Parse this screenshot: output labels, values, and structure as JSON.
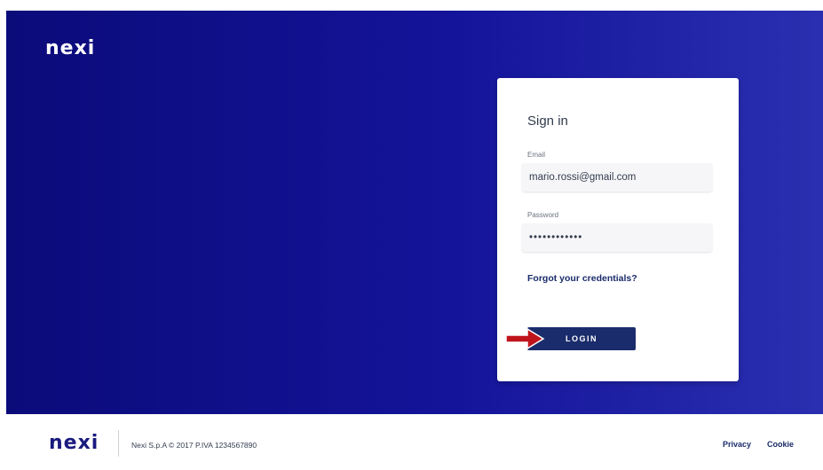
{
  "header": {
    "logo_text": "nexi"
  },
  "login_card": {
    "title": "Sign in",
    "email": {
      "label": "Email",
      "value": "mario.rossi@gmail.com"
    },
    "password": {
      "label": "Password",
      "value": "••••••••••••"
    },
    "forgot_link": "Forgot your credentials?",
    "login_button": "LOGIN"
  },
  "footer": {
    "logo_text": "nexi",
    "copyright": "Nexi S.p.A © 2017 P.IVA 1234567890",
    "links": [
      "Privacy",
      "Cookie"
    ]
  },
  "colors": {
    "hero_gradient_start": "#0b0b7a",
    "hero_gradient_end": "#2a2fb0",
    "brand_navy": "#1a2c6b",
    "arrow_red": "#c0141c"
  },
  "icons": {
    "annotation": "red-arrow-icon"
  }
}
